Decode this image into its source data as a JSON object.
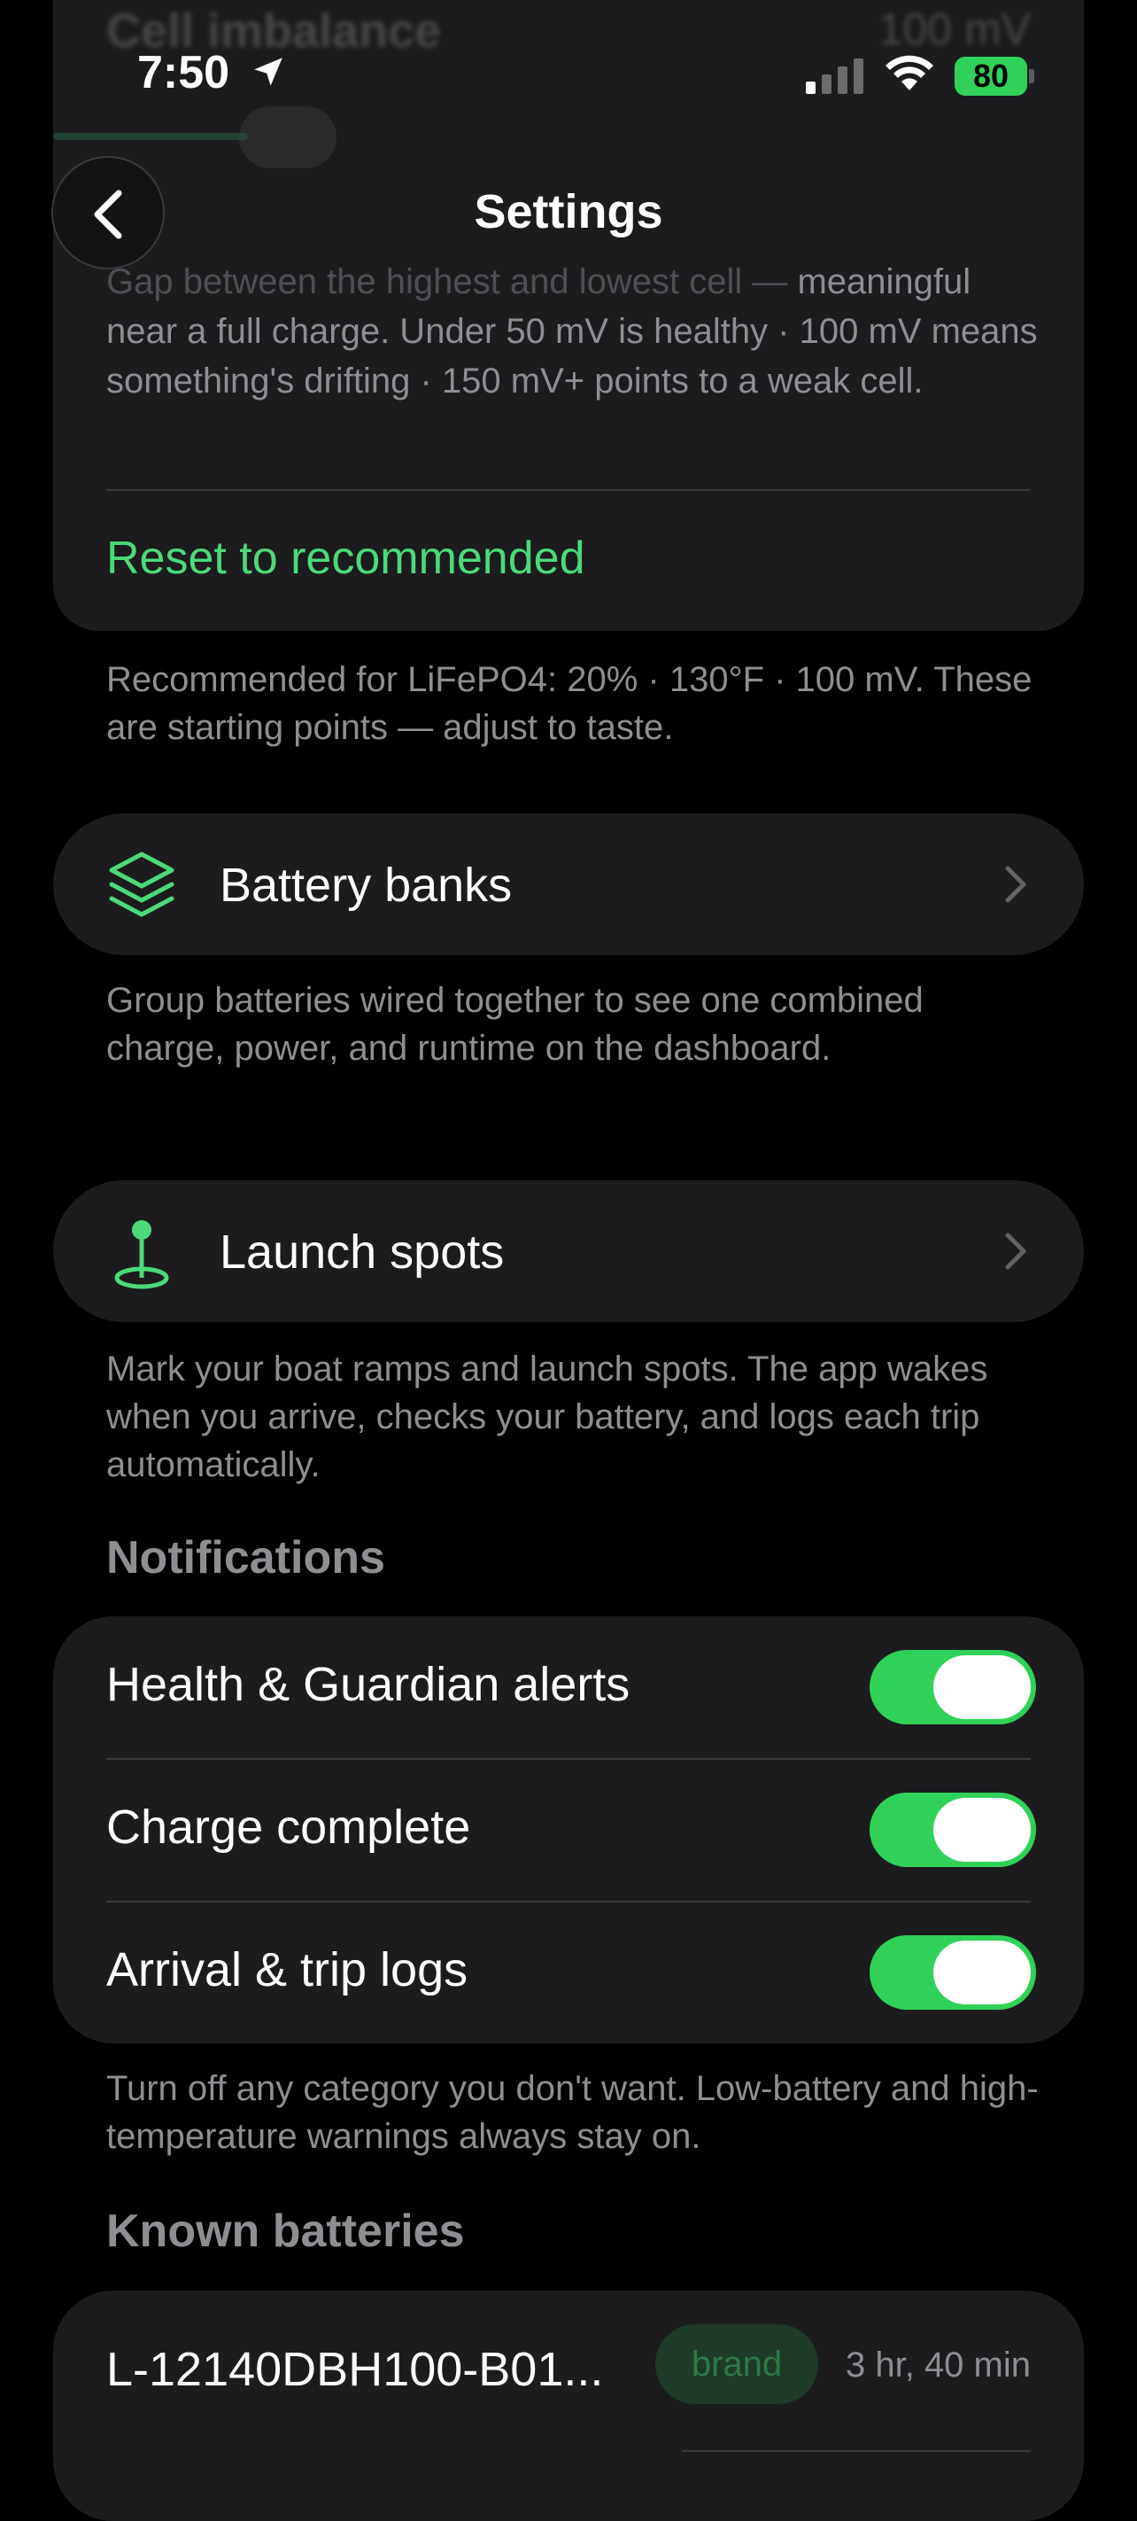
{
  "status_bar": {
    "time": "7:50",
    "battery": "80"
  },
  "nav": {
    "title": "Settings"
  },
  "cell_imbalance": {
    "label": "Cell imbalance",
    "value": "100 mV",
    "desc_faded": "Gap between the highest and lowest cell —",
    "desc": "meaningful near a full charge. Under 50 mV is healthy · 100 mV means something's drifting · 150 mV+ points to a weak cell.",
    "reset_label": "Reset to recommended",
    "footnote": "Recommended for LiFePO4: 20% · 130°F · 100 mV. These are starting points — adjust to taste."
  },
  "battery_banks": {
    "icon": "layers-icon",
    "label": "Battery banks",
    "footnote": "Group batteries wired together to see one combined charge, power, and runtime on the dashboard."
  },
  "launch_spots": {
    "icon": "map-pin-icon",
    "label": "Launch spots",
    "footnote": "Mark your boat ramps and launch spots. The app wakes when you arrive, checks your battery, and logs each trip automatically."
  },
  "notifications": {
    "header": "Notifications",
    "items": [
      {
        "label": "Health & Guardian alerts",
        "enabled": true
      },
      {
        "label": "Charge complete",
        "enabled": true
      },
      {
        "label": "Arrival & trip logs",
        "enabled": true
      }
    ],
    "footnote": "Turn off any category you don't want. Low-battery and high-temperature warnings always stay on."
  },
  "known_batteries": {
    "header": "Known batteries",
    "items": [
      {
        "name": "L-12140DBH100-B01...",
        "badge": "brand",
        "runtime": "3 hr, 40 min"
      }
    ]
  },
  "colors": {
    "accent": "#4cd97b",
    "toggle_on": "#30d158",
    "card": "#1c1c1e",
    "secondary_text": "#8e8e93"
  }
}
